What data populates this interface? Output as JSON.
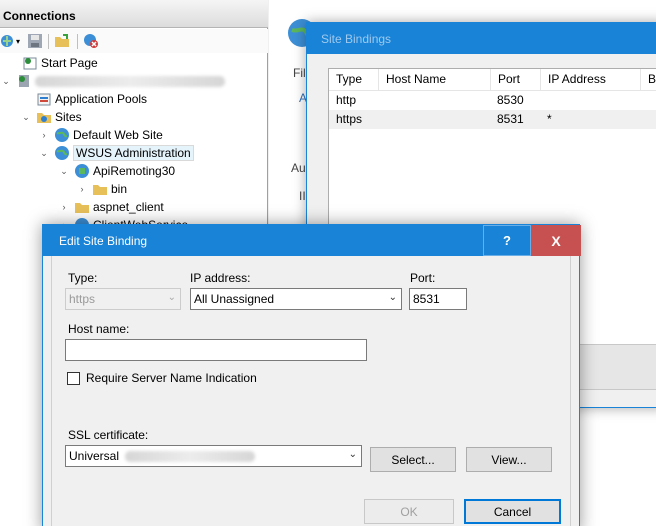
{
  "connections": {
    "title": "Connections",
    "toolbar_icons": [
      "connect-icon",
      "save-icon",
      "open-folder-icon",
      "disconnect-icon"
    ],
    "tree": {
      "start_page": "Start Page",
      "application_pools": "Application Pools",
      "sites": "Sites",
      "default_web_site": "Default Web Site",
      "wsus_administration": "WSUS Administration",
      "api_remoting": "ApiRemoting30",
      "bin": "bin",
      "aspnet_client": "aspnet_client",
      "client_web_service": "ClientWebService"
    }
  },
  "center_panel": {
    "letters": [
      "Fil",
      "A",
      "Au",
      "II"
    ]
  },
  "site_bindings": {
    "title": "Site Bindings",
    "columns": [
      "Type",
      "Host Name",
      "Port",
      "IP Address",
      "Bi"
    ],
    "rows": [
      {
        "type": "http",
        "host": "",
        "port": "8530",
        "ip": ""
      },
      {
        "type": "https",
        "host": "",
        "port": "8531",
        "ip": "*"
      }
    ]
  },
  "edit_binding": {
    "title": "Edit Site Binding",
    "help_label": "?",
    "close_label": "X",
    "type_label": "Type:",
    "type_value": "https",
    "ip_label": "IP address:",
    "ip_value": "All Unassigned",
    "port_label": "Port:",
    "port_value": "8531",
    "host_label": "Host name:",
    "host_value": "",
    "sni_label": "Require Server Name Indication",
    "sni_checked": false,
    "ssl_label": "SSL certificate:",
    "ssl_value": "Universal",
    "select_button": "Select...",
    "view_button": "View...",
    "ok_button": "OK",
    "cancel_button": "Cancel"
  },
  "colors": {
    "titlebar": "#1883d7",
    "close_button": "#c75050"
  }
}
